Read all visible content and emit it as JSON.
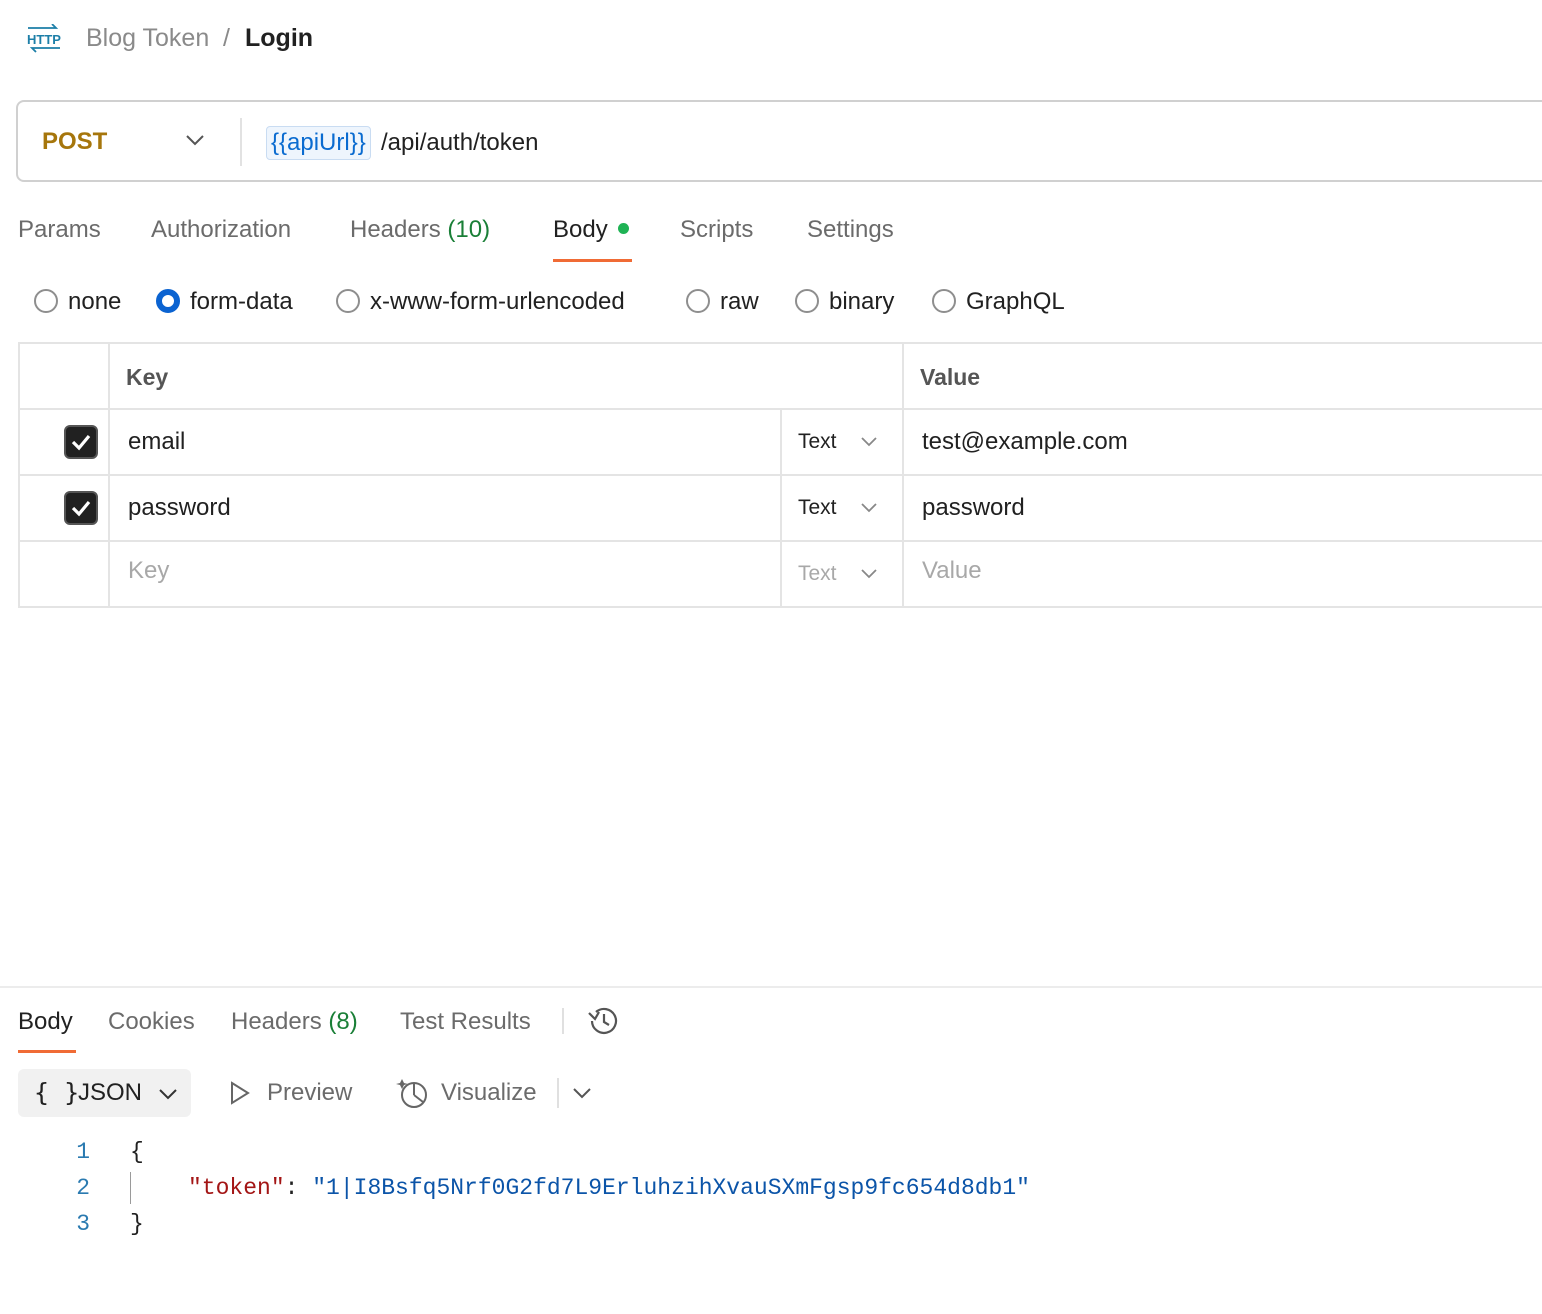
{
  "header": {
    "icon": "http-icon",
    "icon_text": "HTTP",
    "breadcrumb_parent": "Blog Token",
    "breadcrumb_separator": "/",
    "breadcrumb_current": "Login"
  },
  "request": {
    "method": "POST",
    "url_variable": "{{apiUrl}}",
    "url_path": "/api/auth/token"
  },
  "request_tabs": {
    "params": "Params",
    "authorization": "Authorization",
    "headers": "Headers",
    "headers_count": "(10)",
    "body": "Body",
    "scripts": "Scripts",
    "settings": "Settings",
    "active": "Body"
  },
  "body_types": {
    "options": [
      "none",
      "form-data",
      "x-www-form-urlencoded",
      "raw",
      "binary",
      "GraphQL"
    ],
    "selected": "form-data"
  },
  "form_table": {
    "headers": {
      "key": "Key",
      "value": "Value"
    },
    "rows": [
      {
        "checked": true,
        "key": "email",
        "type": "Text",
        "value": "test@example.com"
      },
      {
        "checked": true,
        "key": "password",
        "type": "Text",
        "value": "password"
      }
    ],
    "new_row": {
      "key_placeholder": "Key",
      "type": "Text",
      "value_placeholder": "Value"
    }
  },
  "response_tabs": {
    "body": "Body",
    "cookies": "Cookies",
    "headers": "Headers",
    "headers_count": "(8)",
    "test_results": "Test Results",
    "history_icon": "history-icon",
    "active": "Body"
  },
  "response_toolbar": {
    "format_icon": "{ }",
    "format_label": "JSON",
    "preview_label": "Preview",
    "visualize_label": "Visualize"
  },
  "response_body": {
    "line_numbers": [
      "1",
      "2",
      "3"
    ],
    "open_brace": "{",
    "token_key": "\"token\"",
    "colon": ": ",
    "token_value": "\"1|I8Bsfq5Nrf0G2fd7L9ErluhzihXvauSXmFgsp9fc654d8db1\"",
    "close_brace": "}"
  },
  "colors": {
    "method_post": "#a6760c",
    "url_variable": "#0a6bd0",
    "active_tab_underline": "#f06b35",
    "count_green": "#1a7f37",
    "body_dot": "#1fb355",
    "radio_selected": "#0b63d1",
    "json_key": "#a31515",
    "json_string": "#0b54a8"
  }
}
